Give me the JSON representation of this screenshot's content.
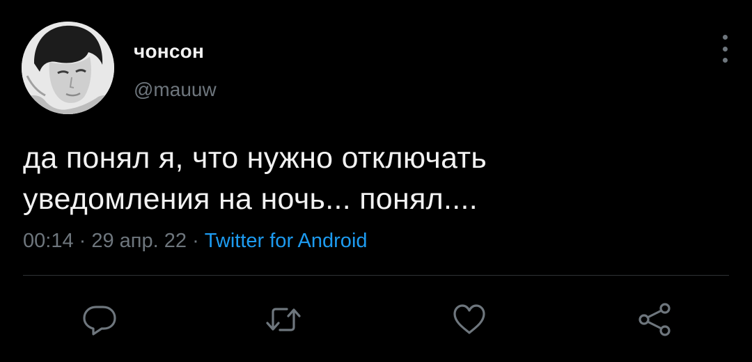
{
  "tweet": {
    "author": {
      "display_name": "чонсон",
      "handle": "@mauuw"
    },
    "text_lines": [
      "да понял я, что нужно отключать",
      "уведомления на ночь... понял...."
    ],
    "meta": {
      "time": "00:14",
      "separator": " · ",
      "date": "29 апр. 22",
      "source": "Twitter for Android"
    },
    "actions": {
      "reply_icon": "speech-bubble",
      "retweet_icon": "retweet-arrows",
      "like_icon": "heart-outline",
      "share_icon": "share-nodes"
    }
  },
  "colors": {
    "background": "#000000",
    "text": "#f2f2f2",
    "muted": "#6e767d",
    "link": "#1d9bf0",
    "divider": "#2f3336"
  }
}
